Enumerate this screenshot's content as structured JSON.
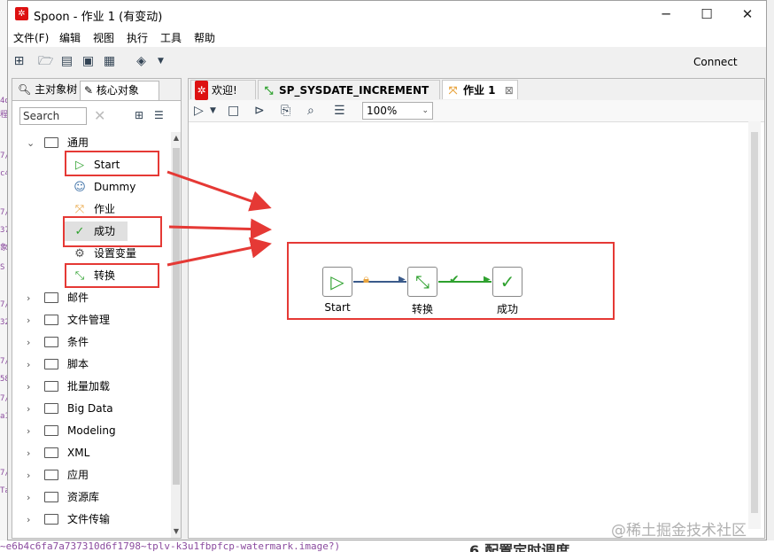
{
  "window": {
    "title": "Spoon - 作业 1 (有变动)",
    "minimize": "─",
    "maximize": "☐",
    "close": "✕"
  },
  "menu": [
    "文件(F)",
    "编辑",
    "视图",
    "执行",
    "工具",
    "帮助"
  ],
  "toolbar": {
    "connect_label": "Connect"
  },
  "left_panel": {
    "tabs": [
      "主对象树",
      "核心对象"
    ],
    "search_placeholder": "Search",
    "general_folder": "通用",
    "general_items": [
      "Start",
      "Dummy",
      "作业",
      "成功",
      "设置变量",
      "转换"
    ],
    "folders": [
      "邮件",
      "文件管理",
      "条件",
      "脚本",
      "批量加载",
      "Big Data",
      "Modeling",
      "XML",
      "应用",
      "资源库",
      "文件传输"
    ]
  },
  "editor_tabs": [
    {
      "label": "欢迎!",
      "icon": "spoon-icon"
    },
    {
      "label": "SP_SYSDATE_INCREMENT",
      "icon": "transformation-icon"
    },
    {
      "label": "作业 1",
      "icon": "job-icon",
      "close": "⊠"
    }
  ],
  "canvas_toolbar": {
    "zoom_value": "100%"
  },
  "job_entries": [
    {
      "label": "Start",
      "icon": "start-icon"
    },
    {
      "label": "转换",
      "icon": "transformation-icon"
    },
    {
      "label": "成功",
      "icon": "success-icon"
    }
  ],
  "watermark": "@稀土掘金技术社区",
  "background": {
    "left_snippets": [
      "4d",
      "程",
      "7/",
      "c4",
      "7/",
      "37",
      "象",
      "S",
      "7/",
      "32",
      "7/",
      "58",
      "7/",
      "a1",
      "7/",
      "Ta"
    ],
    "url": "~e6b4c6fa7a737310d6f1798~tplv-k3u1fbpfcp-watermark.image?)",
    "heading": "6.配置定时调度"
  },
  "colors": {
    "highlight": "#e53935",
    "hop": "#3a5a8a",
    "success_green": "#2ea12e",
    "start_green": "#2ea12e"
  }
}
